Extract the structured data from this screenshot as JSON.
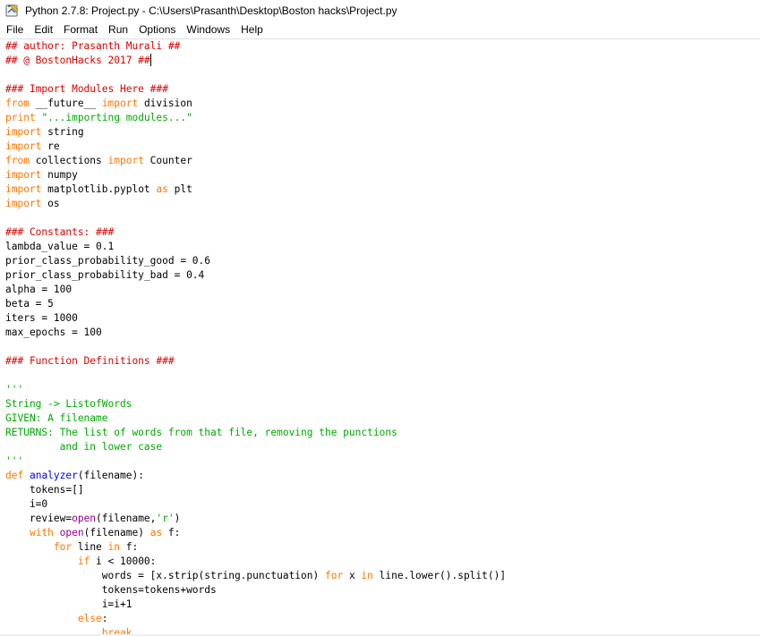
{
  "window": {
    "title": "Python 2.7.8: Project.py - C:\\Users\\Prasanth\\Desktop\\Boston hacks\\Project.py",
    "icon": "python-idle-icon"
  },
  "menu": [
    "File",
    "Edit",
    "Format",
    "Run",
    "Options",
    "Windows",
    "Help"
  ],
  "colors": {
    "keyword": "#ff7700",
    "comment": "#dd0000",
    "string": "#00aa00",
    "definition": "#0000ff",
    "builtin": "#900090"
  },
  "code_lines": [
    [
      [
        "## author: Prasanth Murali ##",
        "comment"
      ]
    ],
    [
      [
        "## @ BostonHacks 2017 ##",
        "comment"
      ]
    ],
    [],
    [
      [
        "### Import Modules Here ###",
        "comment"
      ]
    ],
    [
      [
        "from",
        "keyword"
      ],
      [
        " __future__ ",
        "plain"
      ],
      [
        "import",
        "keyword"
      ],
      [
        " division",
        "plain"
      ]
    ],
    [
      [
        "print",
        "keyword"
      ],
      [
        " ",
        "plain"
      ],
      [
        "\"...importing modules...\"",
        "string"
      ]
    ],
    [
      [
        "import",
        "keyword"
      ],
      [
        " string",
        "plain"
      ]
    ],
    [
      [
        "import",
        "keyword"
      ],
      [
        " re",
        "plain"
      ]
    ],
    [
      [
        "from",
        "keyword"
      ],
      [
        " collections ",
        "plain"
      ],
      [
        "import",
        "keyword"
      ],
      [
        " Counter",
        "plain"
      ]
    ],
    [
      [
        "import",
        "keyword"
      ],
      [
        " numpy",
        "plain"
      ]
    ],
    [
      [
        "import",
        "keyword"
      ],
      [
        " matplotlib.pyplot ",
        "plain"
      ],
      [
        "as",
        "keyword"
      ],
      [
        " plt",
        "plain"
      ]
    ],
    [
      [
        "import",
        "keyword"
      ],
      [
        " os",
        "plain"
      ]
    ],
    [],
    [
      [
        "### Constants: ###",
        "comment"
      ]
    ],
    [
      [
        "lambda_value = 0.1",
        "plain"
      ]
    ],
    [
      [
        "prior_class_probability_good = 0.6",
        "plain"
      ]
    ],
    [
      [
        "prior_class_probability_bad = 0.4",
        "plain"
      ]
    ],
    [
      [
        "alpha = 100",
        "plain"
      ]
    ],
    [
      [
        "beta = 5",
        "plain"
      ]
    ],
    [
      [
        "iters = 1000",
        "plain"
      ]
    ],
    [
      [
        "max_epochs = 100",
        "plain"
      ]
    ],
    [],
    [
      [
        "### Function Definitions ###",
        "comment"
      ]
    ],
    [],
    [
      [
        "'''",
        "string"
      ]
    ],
    [
      [
        "String -> ListofWords",
        "string"
      ]
    ],
    [
      [
        "GIVEN: A filename",
        "string"
      ]
    ],
    [
      [
        "RETURNS: The list of words from that file, removing the punctions",
        "string"
      ]
    ],
    [
      [
        "         and in lower case",
        "string"
      ]
    ],
    [
      [
        "'''",
        "string"
      ]
    ],
    [
      [
        "def",
        "keyword"
      ],
      [
        " ",
        "plain"
      ],
      [
        "analyzer",
        "def"
      ],
      [
        "(filename):",
        "plain"
      ]
    ],
    [
      [
        "    tokens=[]",
        "plain"
      ]
    ],
    [
      [
        "    i=0",
        "plain"
      ]
    ],
    [
      [
        "    review=",
        "plain"
      ],
      [
        "open",
        "builtin"
      ],
      [
        "(filename,",
        "plain"
      ],
      [
        "'r'",
        "string"
      ],
      [
        ")",
        "plain"
      ]
    ],
    [
      [
        "    ",
        "plain"
      ],
      [
        "with",
        "keyword"
      ],
      [
        " ",
        "plain"
      ],
      [
        "open",
        "builtin"
      ],
      [
        "(filename) ",
        "plain"
      ],
      [
        "as",
        "keyword"
      ],
      [
        " f:",
        "plain"
      ]
    ],
    [
      [
        "        ",
        "plain"
      ],
      [
        "for",
        "keyword"
      ],
      [
        " line ",
        "plain"
      ],
      [
        "in",
        "keyword"
      ],
      [
        " f:",
        "plain"
      ]
    ],
    [
      [
        "            ",
        "plain"
      ],
      [
        "if",
        "keyword"
      ],
      [
        " i < 10000:",
        "plain"
      ]
    ],
    [
      [
        "                words = [x.strip(string.punctuation) ",
        "plain"
      ],
      [
        "for",
        "keyword"
      ],
      [
        " x ",
        "plain"
      ],
      [
        "in",
        "keyword"
      ],
      [
        " line.lower().split()]",
        "plain"
      ]
    ],
    [
      [
        "                tokens=tokens+words",
        "plain"
      ]
    ],
    [
      [
        "                i=i+1",
        "plain"
      ]
    ],
    [
      [
        "            ",
        "plain"
      ],
      [
        "else",
        "keyword"
      ],
      [
        ":",
        "plain"
      ]
    ],
    [
      [
        "                break",
        "keyword"
      ]
    ]
  ]
}
